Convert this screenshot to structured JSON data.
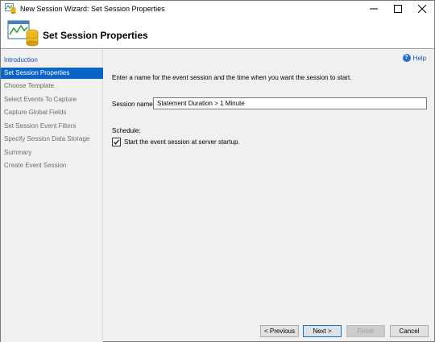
{
  "window": {
    "title": "New Session Wizard: Set Session Properties"
  },
  "banner": {
    "heading": "Set Session Properties"
  },
  "sidebar": {
    "items": [
      {
        "label": "Introduction",
        "state": "link"
      },
      {
        "label": "Set Session Properties",
        "state": "active"
      },
      {
        "label": "Choose Template",
        "state": "disabled"
      },
      {
        "label": "Select Events To Capture",
        "state": "disabled"
      },
      {
        "label": "Capture Global Fields",
        "state": "disabled"
      },
      {
        "label": "Set Session Event Filters",
        "state": "disabled"
      },
      {
        "label": "Specify Session Data Storage",
        "state": "disabled"
      },
      {
        "label": "Summary",
        "state": "disabled"
      },
      {
        "label": "Create Event Session",
        "state": "disabled"
      }
    ]
  },
  "main": {
    "help_label": "Help",
    "intro_text": "Enter a name for the event session and the time when you want the session to start.",
    "session_name_label": "Session name:",
    "session_name_value": "Statement Duration > 1 Minute",
    "schedule_label": "Schedule:",
    "start_at_startup_label": "Start the event session at server startup.",
    "start_at_startup_checked": true
  },
  "buttons": {
    "previous": "< Previous",
    "next": "Next >",
    "finish": "Finish",
    "cancel": "Cancel"
  },
  "colors": {
    "active_nav": "#0a64c8",
    "link": "#1a4bb5",
    "disabled_text": "#6e6e6e"
  },
  "icons": {
    "app": "wizard-icon",
    "help": "help-icon",
    "minimize": "minimize-icon",
    "maximize": "maximize-icon",
    "close": "close-icon"
  }
}
